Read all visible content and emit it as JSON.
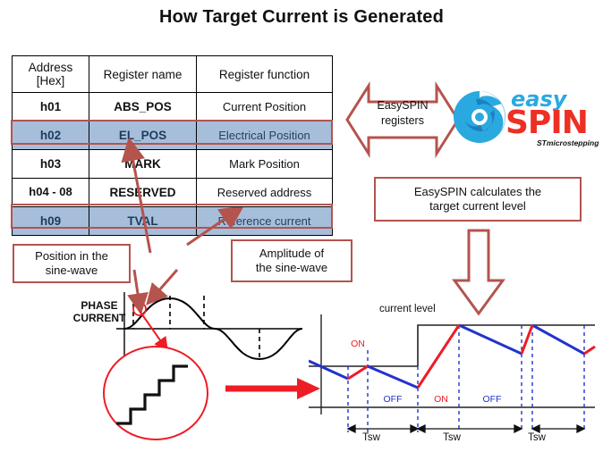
{
  "title": "How Target Current is Generated",
  "table": {
    "headers": [
      "Address [Hex]",
      "Register name",
      "Register function"
    ],
    "header_address_line1": "Address",
    "header_address_line2": "[Hex]",
    "rows": [
      {
        "address": "h01",
        "name": "ABS_POS",
        "function": "Current Position",
        "highlighted": false
      },
      {
        "address": "h02",
        "name": "EL_POS",
        "function": "Electrical  Position",
        "highlighted": true
      },
      {
        "address": "h03",
        "name": "MARK",
        "function": "Mark Position",
        "highlighted": false
      },
      {
        "address": "h04 -   08",
        "name": "RESERVED",
        "function": "Reserved address",
        "highlighted": false
      },
      {
        "address": "h09",
        "name": "TVAL",
        "function": "Reference current",
        "highlighted": true
      }
    ]
  },
  "callouts": {
    "registers_arrow": "EasySPIN registers",
    "registers_arrow_line1": "EasySPIN",
    "registers_arrow_line2": "registers",
    "calculates": "EasySPIN calculates the target current level",
    "calculates_line1": "EasySPIN calculates the",
    "calculates_line2": "target current  level",
    "position": "Position in the sine-wave",
    "position_line1": "Position in  the",
    "position_line2": "sine-wave",
    "amplitude": "Amplitude of the sine-wave",
    "amplitude_line1": "Amplitude  of",
    "amplitude_line2": "the sine-wave"
  },
  "logo": {
    "easy": "easy",
    "spin": "SPIN",
    "tagline": "STmicrostepping"
  },
  "sine_chart": {
    "label_line1": "PHASE",
    "label_line2": "CURRENT"
  },
  "chopper_chart": {
    "current_level_label": "current level",
    "on_label": "ON",
    "off_label": "OFF",
    "tsw_label": "Tsw",
    "segments": [
      {
        "state": "ON"
      },
      {
        "state": "OFF"
      },
      {
        "state": "ON"
      },
      {
        "state": "OFF"
      }
    ],
    "periods": [
      "Tsw",
      "Tsw",
      "Tsw"
    ]
  },
  "colors": {
    "accent_red": "#b5534e",
    "highlight_row": "#a7bedb",
    "rise_red": "#ee1c25",
    "fall_blue": "#2233cc",
    "logo_blue": "#2aa9e0",
    "logo_red": "#ed3024"
  },
  "chart_data": {
    "type": "line",
    "title": "How Target Current is Generated",
    "charts": [
      {
        "name": "phase-current-sine",
        "type": "line",
        "ylabel": "PHASE CURRENT",
        "description": "one full sine period with dashed sample markers",
        "markers_x": [
          148,
          190,
          228,
          290
        ]
      },
      {
        "name": "current-chopping",
        "type": "line",
        "series": [
          {
            "name": "rising (ON)",
            "color": "#ee1c25"
          },
          {
            "name": "falling (OFF)",
            "color": "#2233cc"
          }
        ],
        "annotations": [
          "current level",
          "ON",
          "OFF",
          "Tsw"
        ],
        "periods": 3
      }
    ]
  }
}
